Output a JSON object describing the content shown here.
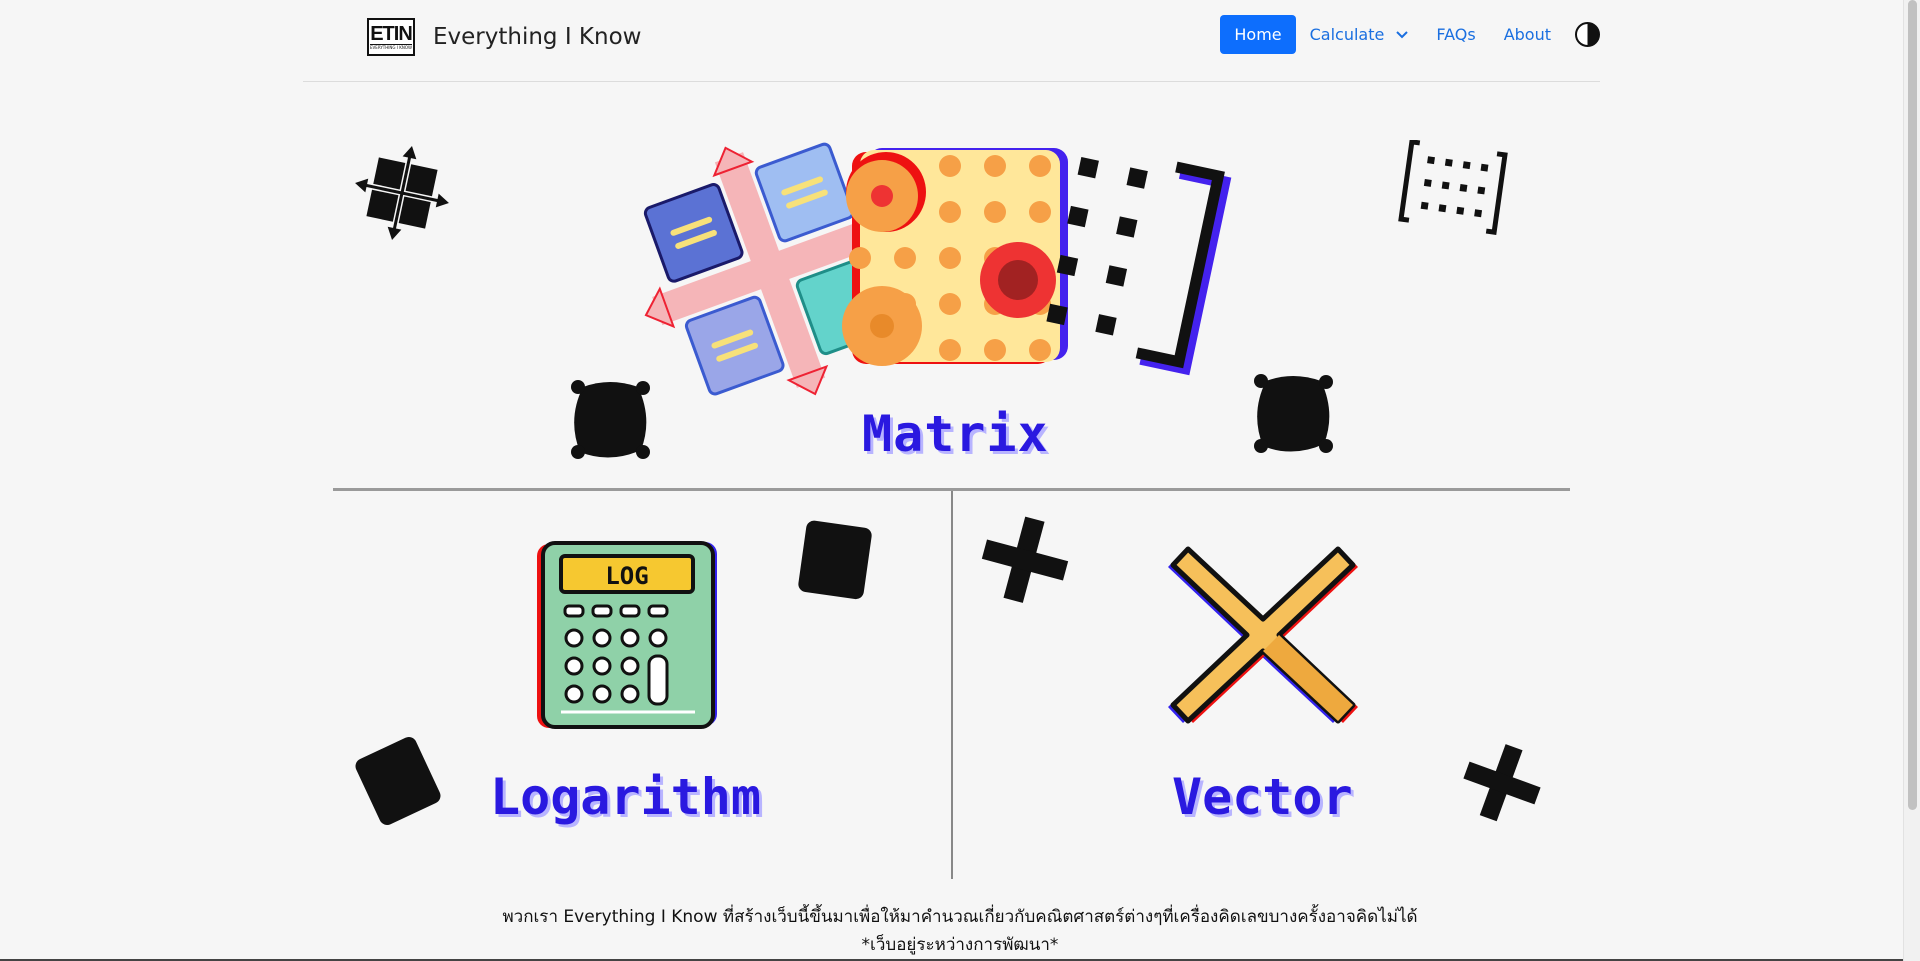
{
  "brand": {
    "logo_text": "ETIN",
    "logo_subtext": "EVERYTHING I KNOW",
    "name": "Everything I Know"
  },
  "nav": {
    "home": "Home",
    "calculate": "Calculate",
    "faqs": "FAQs",
    "about": "About",
    "theme_icon": "contrast-icon"
  },
  "sections": {
    "matrix": "Matrix",
    "logarithm": "Logarithm",
    "vector": "Vector",
    "log_screen": "LOG"
  },
  "footer": {
    "line1": "พวกเรา Everything I Know ที่สร้างเว็บนี้ขึ้นมาเพื่อให้มาคำนวณเกี่ยวกับคณิตศาสตร์ต่างๆที่เครื่องคิดเลขบางครั้งอาจคิดไม่ได้",
    "line2": "*เว็บอยู่ระหว่างการพัฒนา*"
  },
  "colors": {
    "accent": "#0d6efd",
    "label": "#2a19e0",
    "vector_x": "#f6c05a",
    "calculator": "#8fd1a8"
  }
}
